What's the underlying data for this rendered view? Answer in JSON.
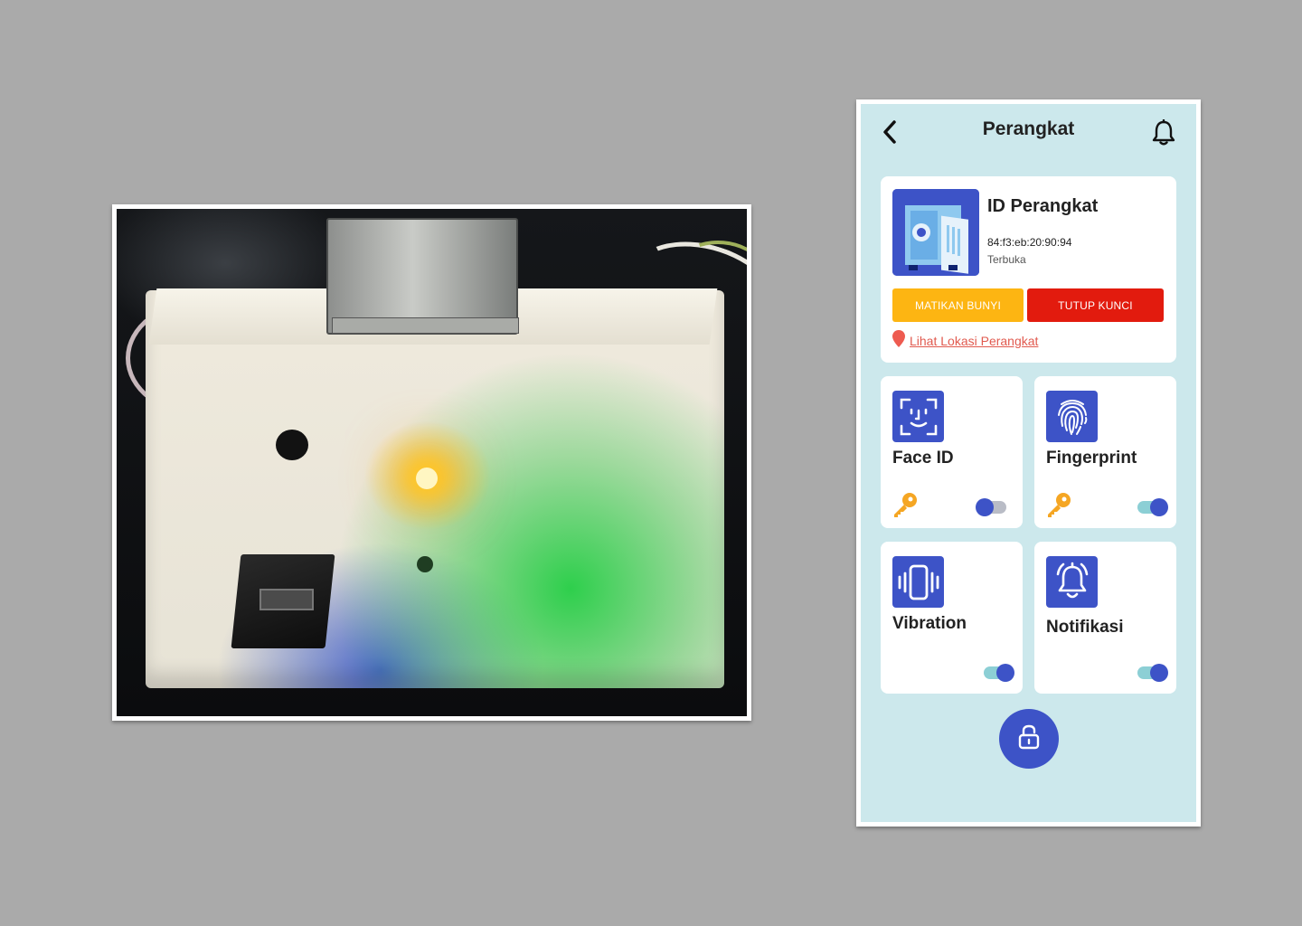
{
  "app": {
    "title": "Perangkat",
    "icons": {
      "back": "chevron-left-icon",
      "notification": "bell-icon"
    }
  },
  "device": {
    "title": "ID Perangkat",
    "mac": "84:f3:eb:20:90:94",
    "status": "Terbuka",
    "image_icon": "safe-vault-icon",
    "mute_button": "MATIKAN BUNYI",
    "lock_button": "TUTUP KUNCI",
    "location_link": "Lihat Lokasi Perangkat",
    "location_icon": "map-pin-icon"
  },
  "features": [
    {
      "label": "Face ID",
      "icon": "face-id-icon",
      "has_key": true,
      "enabled": false
    },
    {
      "label": "Fingerprint",
      "icon": "fingerprint-icon",
      "has_key": true,
      "enabled": true
    },
    {
      "label": "Vibration",
      "icon": "vibration-icon",
      "has_key": false,
      "enabled": true
    },
    {
      "label": "Notifikasi",
      "icon": "bell-ring-icon",
      "has_key": false,
      "enabled": true
    }
  ],
  "fab_icon": "padlock-open-icon",
  "colors": {
    "background": "#aaaaaa",
    "app_background": "#cce8ec",
    "primary": "#3d53c7",
    "mute_button": "#fdb512",
    "lock_button": "#e21b0e",
    "link": "#e15a4f",
    "key": "#f5a623",
    "toggle_on_track": "#8ccfd5",
    "toggle_off_track": "#b9bcc6"
  }
}
